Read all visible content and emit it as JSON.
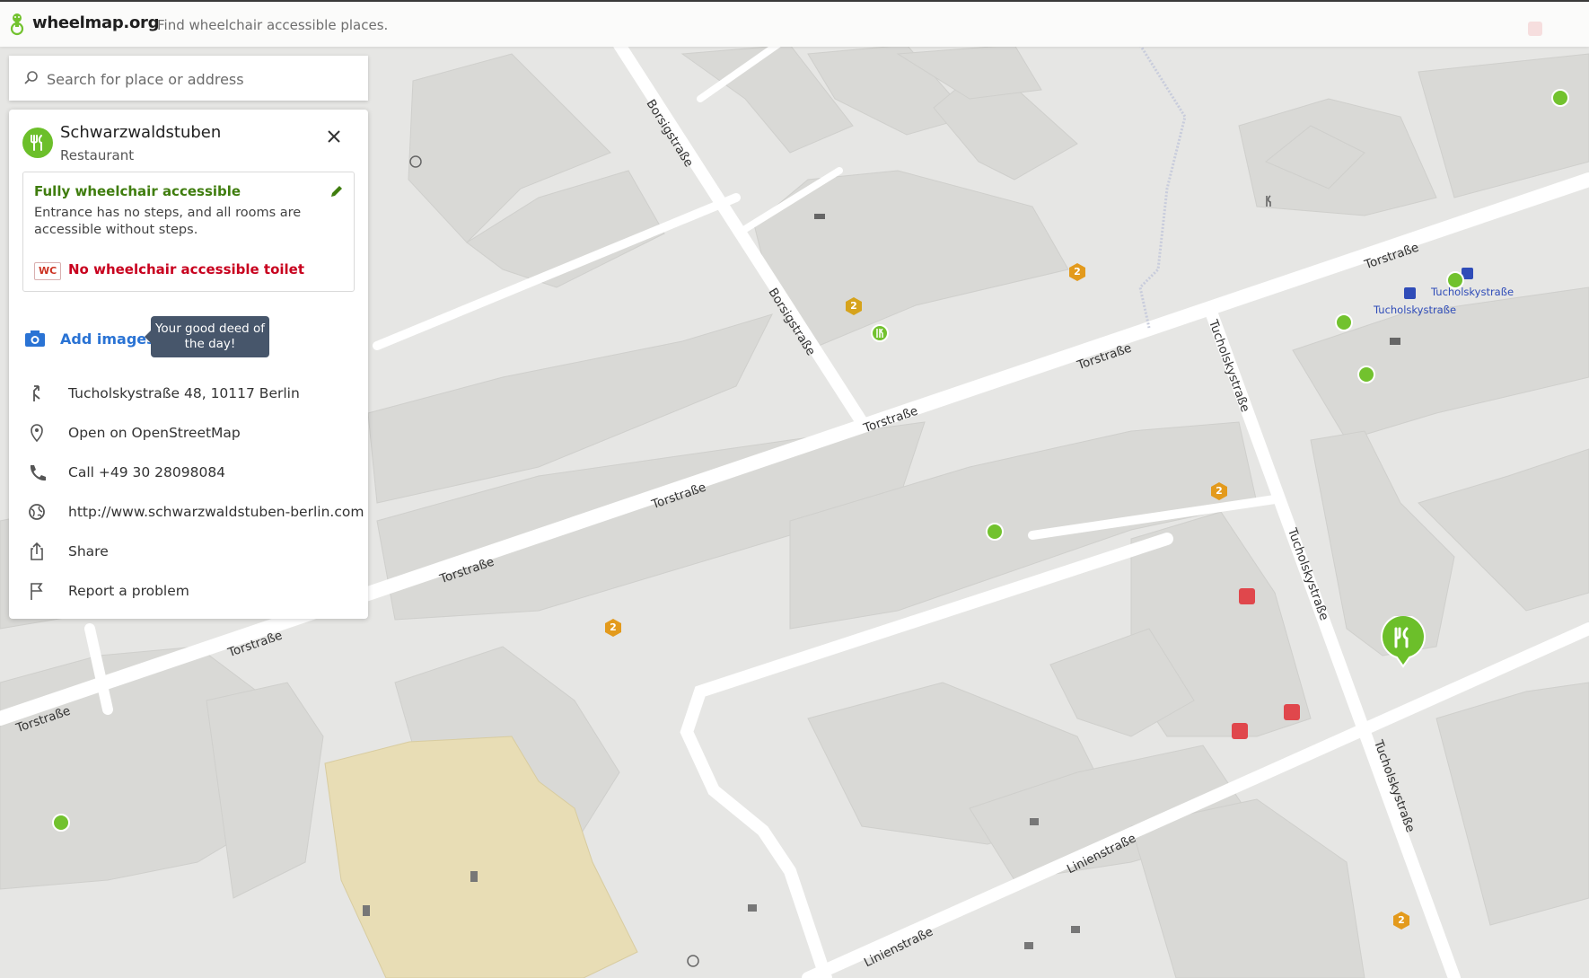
{
  "header": {
    "logo_text": "wheelmap.org",
    "tagline": "Find wheelchair accessible places."
  },
  "search": {
    "placeholder": "Search for place or address"
  },
  "place": {
    "name": "Schwarzwaldstuben",
    "category": "Restaurant",
    "icon": "restaurant-icon",
    "accessibility": {
      "title": "Fully wheelchair accessible",
      "description": "Entrance has no steps, and all rooms are accessible without steps.",
      "toilet_badge": "WC",
      "toilet_text": "No wheelchair accessible toilet"
    },
    "add_images_label": "Add images",
    "tooltip_text": "Your good deed of the day!",
    "address": "Tucholskystraße 48, 10117 Berlin",
    "osm_link": "Open on OpenStreetMap",
    "phone": "Call +49 30 28098084",
    "website": "http://www.schwarzwaldstuben-berlin.com",
    "share": "Share",
    "report": "Report a problem"
  },
  "map": {
    "streets": {
      "borsig1": "Borsigstraße",
      "borsig2": "Borsigstraße",
      "tor1": "Torstraße",
      "tor2": "Torstraße",
      "tor3": "Torstraße",
      "tor4": "Torstraße",
      "tor5": "Torstraße",
      "tor6": "Torstraße",
      "tor7": "Torstraße",
      "tuch1": "Tucholskystraße",
      "tuch2": "Tucholskystraße",
      "tuch3": "Tucholskystraße",
      "linien1": "Linienstraße",
      "linien2": "Linienstraße"
    },
    "stops": {
      "stop1": "Tucholskystraße",
      "stop2": "Tucholskystraße"
    },
    "cluster_count": "2",
    "colors": {
      "accessible": "#72c22e",
      "cluster": "#e39a1c",
      "not_accessible": "#e0474c",
      "building": "#d8d8d5",
      "road": "#ffffff",
      "park_area": "#e8ddb5"
    }
  }
}
